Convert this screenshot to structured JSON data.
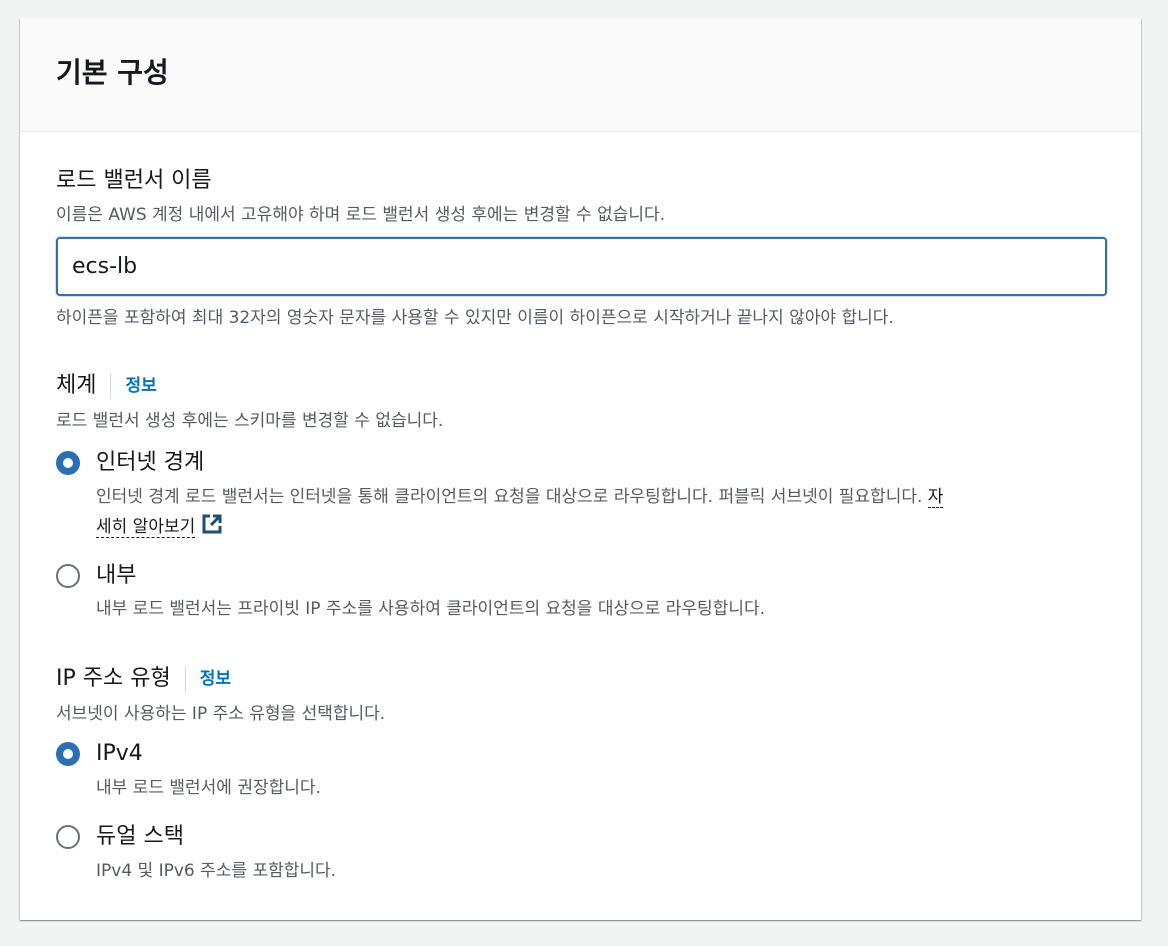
{
  "panel": {
    "title": "기본 구성"
  },
  "lb_name": {
    "label": "로드 밸런서 이름",
    "description": "이름은 AWS 계정 내에서 고유해야 하며 로드 밸런서 생성 후에는 변경할 수 없습니다.",
    "value": "ecs-lb",
    "constraint": "하이픈을 포함하여 최대 32자의 영숫자 문자를 사용할 수 있지만 이름이 하이픈으로 시작하거나 끝나지 않아야 합니다."
  },
  "scheme": {
    "label": "체계",
    "info": "정보",
    "description": "로드 밸런서 생성 후에는 스키마를 변경할 수 없습니다.",
    "options": [
      {
        "label": "인터넷 경계",
        "description_line1": "인터넷 경계 로드 밸런서는 인터넷을 통해 클라이언트의 요청을 대상으로 라우팅합니다. 퍼블릭 서브넷이 필요합니다. ",
        "link_part1": "자",
        "link_part2": "세히 알아보기",
        "icon": "external-link-icon",
        "selected": true
      },
      {
        "label": "내부",
        "description": "내부 로드 밸런서는 프라이빗 IP 주소를 사용하여 클라이언트의 요청을 대상으로 라우팅합니다.",
        "selected": false
      }
    ]
  },
  "ip_type": {
    "label": "IP 주소 유형",
    "info": "정보",
    "description": "서브넷이 사용하는 IP 주소 유형을 선택합니다.",
    "options": [
      {
        "label": "IPv4",
        "description": "내부 로드 밸런서에 권장합니다.",
        "selected": true
      },
      {
        "label": "듀얼 스택",
        "description": "IPv4 및 IPv6 주소를 포함합니다.",
        "selected": false
      }
    ]
  },
  "colors": {
    "accent": "#2a6fb3",
    "link": "#0073bb",
    "input_border": "#3a6ea5"
  }
}
